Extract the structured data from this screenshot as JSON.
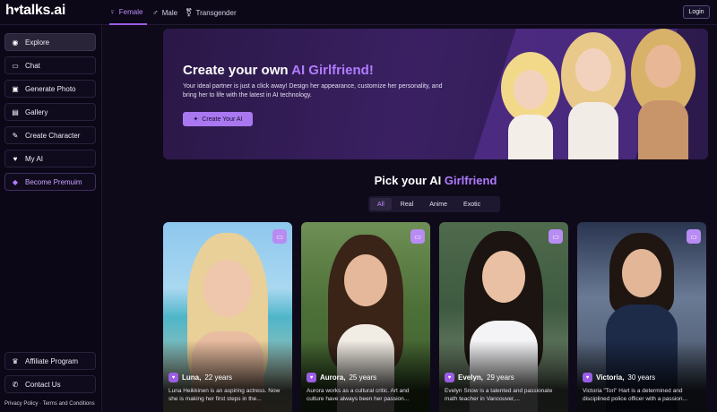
{
  "brand": {
    "name": "hotalks.ai",
    "logo_prefix": "h",
    "logo_suffix": "talks.ai"
  },
  "gender_tabs": [
    {
      "label": "Female",
      "icon": "female-icon",
      "active": true
    },
    {
      "label": "Male",
      "icon": "male-icon",
      "active": false
    },
    {
      "label": "Transgender",
      "icon": "transgender-icon",
      "active": false
    }
  ],
  "login_label": "Login",
  "sidebar": {
    "items": [
      {
        "label": "Explore",
        "icon": "compass-icon",
        "active": true
      },
      {
        "label": "Chat",
        "icon": "chat-icon"
      },
      {
        "label": "Generate Photo",
        "icon": "photo-icon"
      },
      {
        "label": "Gallery",
        "icon": "gallery-icon"
      },
      {
        "label": "Create Character",
        "icon": "edit-icon"
      },
      {
        "label": "My AI",
        "icon": "heart-icon"
      },
      {
        "label": "Become Premuim",
        "icon": "diamond-icon"
      }
    ],
    "bottom_items": [
      {
        "label": "Affiliate Program",
        "icon": "trophy-icon"
      },
      {
        "label": "Contact Us",
        "icon": "phone-icon"
      }
    ],
    "footer": "Privacy Policy · Terms and Conditions"
  },
  "hero": {
    "title_prefix": "Create your own ",
    "title_accent": "AI Girlfriend!",
    "description": "Your ideal partner is just a click away! Design her appearance, customize her personality, and bring her to life with the latest in AI technology.",
    "button_label": "Create Your AI"
  },
  "pick": {
    "title_prefix": "Pick your AI ",
    "title_accent": "Girlfriend",
    "filters": [
      "All",
      "Real",
      "Anime",
      "Exotic"
    ],
    "active_filter": "All"
  },
  "cards": [
    {
      "name": "Luna,",
      "age": "22 years",
      "desc": "Luna Heikkinen is an aspiring actress. Now she is making her first steps in the..."
    },
    {
      "name": "Aurora,",
      "age": "25 years",
      "desc": "Aurora works as a cultural critic. Art and culture have always been her passion..."
    },
    {
      "name": "Evelyn,",
      "age": "29 years",
      "desc": "Evelyn Snow is a talented and passionate math teacher in Vancouver,..."
    },
    {
      "name": "Victoria,",
      "age": "30 years",
      "desc": "Victoria \"Tori\" Hart is a determined and disciplined police officer with a passion..."
    }
  ],
  "colors": {
    "accent": "#9b5de5",
    "accent_light": "#b07cff",
    "bg": "#0f0a1a"
  }
}
